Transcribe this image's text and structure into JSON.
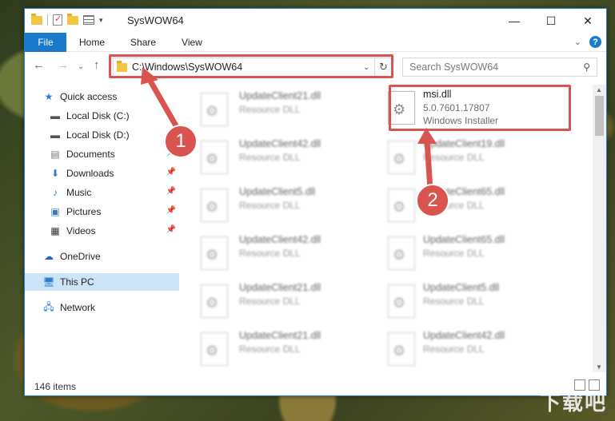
{
  "window": {
    "title": "SysWOW64"
  },
  "ribbon": {
    "tabs": [
      "File",
      "Home",
      "Share",
      "View"
    ]
  },
  "address": {
    "path": "C:\\Windows\\SysWOW64"
  },
  "search": {
    "placeholder": "Search SysWOW64"
  },
  "sidebar": {
    "items": [
      {
        "label": "Quick access",
        "icon": "star-icon",
        "pinned": false
      },
      {
        "label": "Local Disk (C:)",
        "icon": "drive-icon",
        "pinned": false
      },
      {
        "label": "Local Disk (D:)",
        "icon": "drive-icon",
        "pinned": false
      },
      {
        "label": "Documents",
        "icon": "documents-icon",
        "pinned": true
      },
      {
        "label": "Downloads",
        "icon": "download-icon",
        "pinned": true
      },
      {
        "label": "Music",
        "icon": "music-icon",
        "pinned": true
      },
      {
        "label": "Pictures",
        "icon": "pictures-icon",
        "pinned": true
      },
      {
        "label": "Videos",
        "icon": "videos-icon",
        "pinned": true
      },
      {
        "label": "OneDrive",
        "icon": "cloud-icon",
        "pinned": false
      },
      {
        "label": "This PC",
        "icon": "computer-icon",
        "pinned": false
      },
      {
        "label": "Network",
        "icon": "network-icon",
        "pinned": false
      }
    ]
  },
  "files": {
    "highlight": {
      "name": "msi.dll",
      "version": "5.0.7601.17807",
      "type": "Windows Installer"
    },
    "left": [
      {
        "name": "UpdateClient21.dll",
        "type": "Resource DLL"
      },
      {
        "name": "UpdateClient42.dll",
        "type": "Resource DLL"
      },
      {
        "name": "UpdateClient5.dll",
        "type": "Resource DLL"
      },
      {
        "name": "UpdateClient42.dll",
        "type": "Resource DLL"
      },
      {
        "name": "UpdateClient21.dll",
        "type": "Resource DLL"
      },
      {
        "name": "UpdateClient21.dll",
        "type": "Resource DLL"
      }
    ],
    "right": [
      {
        "name": "UpdateClient19.dll",
        "type": "Resource DLL"
      },
      {
        "name": "UpdateClient65.dll",
        "type": "Resource DLL"
      },
      {
        "name": "UpdateClient65.dll",
        "type": "Resource DLL"
      },
      {
        "name": "UpdateClient5.dll",
        "type": "Resource DLL"
      },
      {
        "name": "UpdateClient42.dll",
        "type": "Resource DLL"
      }
    ]
  },
  "status": {
    "items": "146 items"
  },
  "callouts": {
    "one": "1",
    "two": "2"
  },
  "colors": {
    "accent": "#1979ca",
    "highlight_box": "#d9534f",
    "selected": "#cce4f7"
  }
}
